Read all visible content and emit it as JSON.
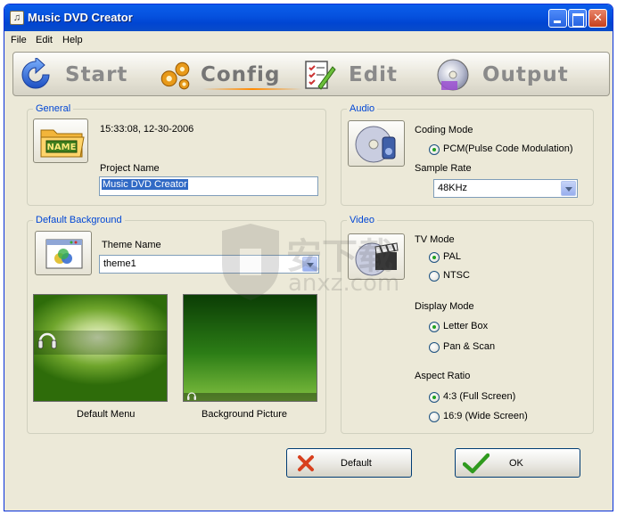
{
  "window": {
    "title": "Music DVD Creator"
  },
  "menu": {
    "items": [
      "File",
      "Edit",
      "Help"
    ]
  },
  "toolbar": {
    "items": [
      {
        "label": "Start",
        "icon": "refresh-arrow-icon"
      },
      {
        "label": "Config",
        "icon": "gears-icon",
        "active": true
      },
      {
        "label": "Edit",
        "icon": "checklist-pencil-icon"
      },
      {
        "label": "Output",
        "icon": "disc-icon"
      }
    ]
  },
  "general": {
    "legend": "General",
    "timestamp": "15:33:08, 12-30-2006",
    "project_name_label": "Project Name",
    "project_name_value": "Music DVD Creator",
    "icon": "name-folder-icon",
    "icon_text": "NAME"
  },
  "audio": {
    "legend": "Audio",
    "coding_mode_label": "Coding Mode",
    "coding_mode_option": "PCM(Pulse Code Modulation)",
    "sample_rate_label": "Sample Rate",
    "sample_rate_value": "48KHz",
    "icon": "speaker-disc-icon"
  },
  "background": {
    "legend": "Default Background",
    "theme_name_label": "Theme Name",
    "theme_name_value": "theme1",
    "default_menu_label": "Default Menu",
    "background_picture_label": "Background Picture",
    "icon": "theme-window-icon"
  },
  "video": {
    "legend": "Video",
    "tv_mode_label": "TV Mode",
    "tv_mode_options": [
      "PAL",
      "NTSC"
    ],
    "tv_mode_selected": "PAL",
    "display_mode_label": "Display Mode",
    "display_mode_options": [
      "Letter Box",
      "Pan & Scan"
    ],
    "display_mode_selected": "Letter Box",
    "aspect_ratio_label": "Aspect Ratio",
    "aspect_ratio_options": [
      "4:3 (Full Screen)",
      "16:9 (Wide Screen)"
    ],
    "aspect_ratio_selected": "4:3 (Full Screen)",
    "icon": "clapperboard-icon"
  },
  "buttons": {
    "default_label": "Default",
    "ok_label": "OK"
  },
  "watermark": {
    "text": "安下载",
    "url": "anxz.com"
  },
  "colors": {
    "titlebar": "#0054E3",
    "legend_text": "#0046D5",
    "window_bg": "#ECE9D8",
    "selection": "#316AC5",
    "radio_dot": "#21A121"
  }
}
